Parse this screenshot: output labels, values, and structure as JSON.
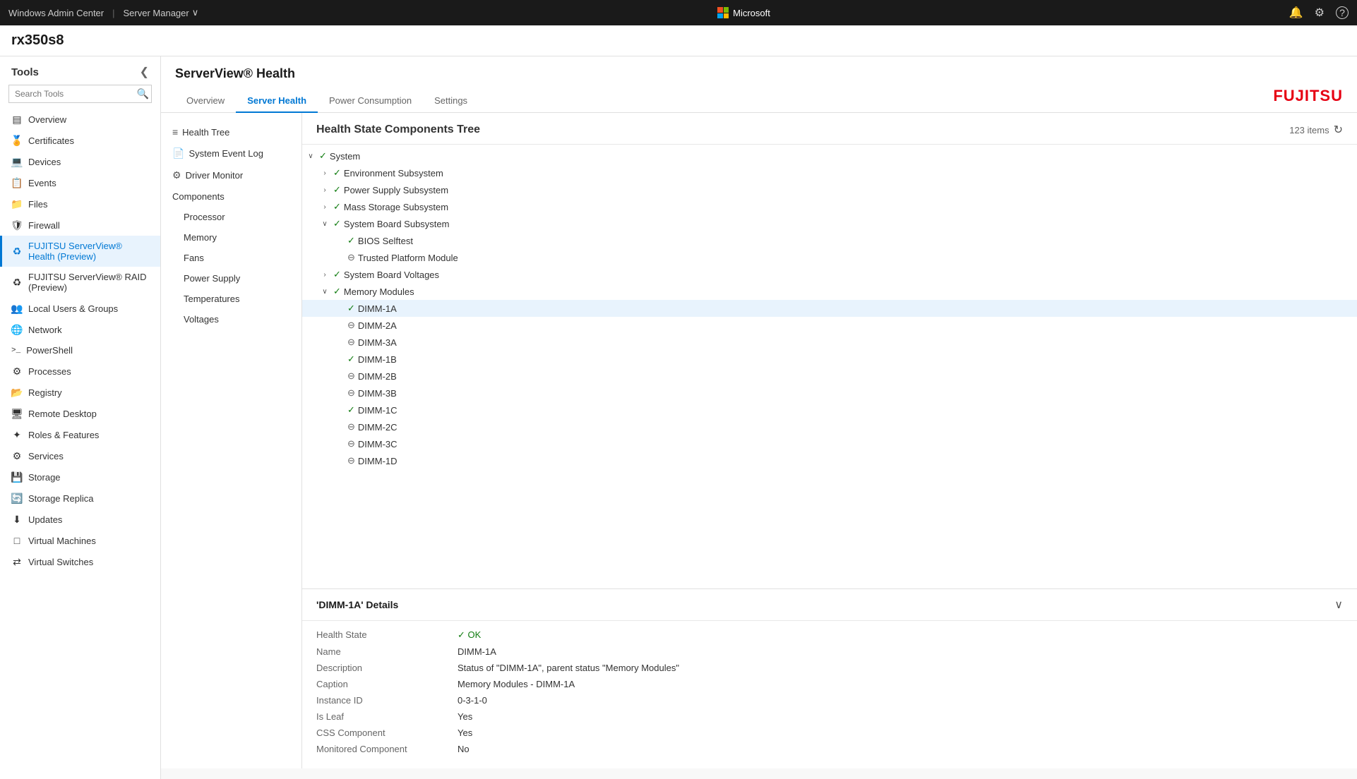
{
  "topbar": {
    "app_name": "Windows Admin Center",
    "server_label": "Server Manager",
    "microsoft_label": "Microsoft",
    "chevron": "∨",
    "bell_icon": "🔔",
    "gear_icon": "⚙",
    "help_icon": "?"
  },
  "server": {
    "name": "rx350s8"
  },
  "sidebar": {
    "title": "Tools",
    "collapse_icon": "❮",
    "search_placeholder": "Search Tools",
    "nav_items": [
      {
        "id": "overview",
        "label": "Overview",
        "icon": "▤"
      },
      {
        "id": "certificates",
        "label": "Certificates",
        "icon": "🏅"
      },
      {
        "id": "devices",
        "label": "Devices",
        "icon": "💻"
      },
      {
        "id": "events",
        "label": "Events",
        "icon": "📋"
      },
      {
        "id": "files",
        "label": "Files",
        "icon": "📁"
      },
      {
        "id": "firewall",
        "label": "Firewall",
        "icon": "🛡"
      },
      {
        "id": "fujitsu-health",
        "label": "FUJITSU ServerView® Health (Preview)",
        "icon": "♻",
        "active": true
      },
      {
        "id": "fujitsu-raid",
        "label": "FUJITSU ServerView® RAID (Preview)",
        "icon": "♻"
      },
      {
        "id": "local-users",
        "label": "Local Users & Groups",
        "icon": "👥"
      },
      {
        "id": "network",
        "label": "Network",
        "icon": "🌐"
      },
      {
        "id": "powershell",
        "label": "PowerShell",
        "icon": ">_"
      },
      {
        "id": "processes",
        "label": "Processes",
        "icon": "⚙"
      },
      {
        "id": "registry",
        "label": "Registry",
        "icon": "📂"
      },
      {
        "id": "remote-desktop",
        "label": "Remote Desktop",
        "icon": "🖥"
      },
      {
        "id": "roles-features",
        "label": "Roles & Features",
        "icon": "✦"
      },
      {
        "id": "services",
        "label": "Services",
        "icon": "⚙"
      },
      {
        "id": "storage",
        "label": "Storage",
        "icon": "💾"
      },
      {
        "id": "storage-replica",
        "label": "Storage Replica",
        "icon": "🔄"
      },
      {
        "id": "updates",
        "label": "Updates",
        "icon": "⬇"
      },
      {
        "id": "virtual-machines",
        "label": "Virtual Machines",
        "icon": "□"
      },
      {
        "id": "virtual-switches",
        "label": "Virtual Switches",
        "icon": "⇄"
      }
    ]
  },
  "plugin": {
    "title": "ServerView® Health",
    "tabs": [
      {
        "id": "overview",
        "label": "Overview"
      },
      {
        "id": "server-health",
        "label": "Server Health",
        "active": true
      },
      {
        "id": "power-consumption",
        "label": "Power Consumption"
      },
      {
        "id": "settings",
        "label": "Settings"
      }
    ],
    "fujitsu_logo": "FUJITSU"
  },
  "health_nav": {
    "items": [
      {
        "id": "health-tree",
        "label": "Health Tree",
        "icon": "≡",
        "level": 0
      },
      {
        "id": "system-event-log",
        "label": "System Event Log",
        "icon": "📄",
        "level": 0
      },
      {
        "id": "driver-monitor",
        "label": "Driver Monitor",
        "icon": "⚙",
        "level": 0
      },
      {
        "id": "components",
        "label": "Components",
        "icon": "",
        "level": 0
      },
      {
        "id": "processor",
        "label": "Processor",
        "level": 1
      },
      {
        "id": "memory",
        "label": "Memory",
        "level": 1
      },
      {
        "id": "fans",
        "label": "Fans",
        "level": 1
      },
      {
        "id": "power-supply",
        "label": "Power Supply",
        "level": 1
      },
      {
        "id": "temperatures",
        "label": "Temperatures",
        "level": 1
      },
      {
        "id": "voltages",
        "label": "Voltages",
        "level": 1
      }
    ]
  },
  "health_tree": {
    "title": "Health State Components Tree",
    "item_count": "123 items",
    "items": [
      {
        "id": "system",
        "label": "System",
        "status": "check",
        "level": 0,
        "expandable": true,
        "expanded": true
      },
      {
        "id": "env-subsystem",
        "label": "Environment Subsystem",
        "status": "check",
        "level": 1,
        "expandable": true
      },
      {
        "id": "power-supply-sub",
        "label": "Power Supply Subsystem",
        "status": "check",
        "level": 1,
        "expandable": true
      },
      {
        "id": "mass-storage-sub",
        "label": "Mass Storage Subsystem",
        "status": "check",
        "level": 1,
        "expandable": true
      },
      {
        "id": "system-board-sub",
        "label": "System Board Subsystem",
        "status": "check",
        "level": 1,
        "expandable": true,
        "expanded": true
      },
      {
        "id": "bios-selftest",
        "label": "BIOS Selftest",
        "status": "check",
        "level": 2,
        "expandable": false
      },
      {
        "id": "trusted-platform",
        "label": "Trusted Platform Module",
        "status": "dash",
        "level": 2,
        "expandable": false
      },
      {
        "id": "system-board-voltages",
        "label": "System Board Voltages",
        "status": "check",
        "level": 1,
        "expandable": true
      },
      {
        "id": "memory-modules",
        "label": "Memory Modules",
        "status": "check",
        "level": 1,
        "expandable": true,
        "expanded": true
      },
      {
        "id": "dimm-1a",
        "label": "DIMM-1A",
        "status": "check",
        "level": 2,
        "expandable": false,
        "selected": true
      },
      {
        "id": "dimm-2a",
        "label": "DIMM-2A",
        "status": "dash",
        "level": 2,
        "expandable": false
      },
      {
        "id": "dimm-3a",
        "label": "DIMM-3A",
        "status": "dash",
        "level": 2,
        "expandable": false
      },
      {
        "id": "dimm-1b",
        "label": "DIMM-1B",
        "status": "check",
        "level": 2,
        "expandable": false
      },
      {
        "id": "dimm-2b",
        "label": "DIMM-2B",
        "status": "dash",
        "level": 2,
        "expandable": false
      },
      {
        "id": "dimm-3b",
        "label": "DIMM-3B",
        "status": "dash",
        "level": 2,
        "expandable": false
      },
      {
        "id": "dimm-1c",
        "label": "DIMM-1C",
        "status": "check",
        "level": 2,
        "expandable": false
      },
      {
        "id": "dimm-2c",
        "label": "DIMM-2C",
        "status": "dash",
        "level": 2,
        "expandable": false
      },
      {
        "id": "dimm-3c",
        "label": "DIMM-3C",
        "status": "dash",
        "level": 2,
        "expandable": false
      },
      {
        "id": "dimm-1d",
        "label": "DIMM-1D",
        "status": "dash",
        "level": 2,
        "expandable": false
      }
    ]
  },
  "details": {
    "title": "'DIMM-1A' Details",
    "collapse_icon": "∨",
    "fields": [
      {
        "label": "Health State",
        "value": "✓ OK",
        "value_class": "ok"
      },
      {
        "label": "Name",
        "value": "DIMM-1A"
      },
      {
        "label": "Description",
        "value": "Status of \"DIMM-1A\", parent status \"Memory Modules\""
      },
      {
        "label": "Caption",
        "value": "Memory Modules - DIMM-1A"
      },
      {
        "label": "Instance ID",
        "value": "0-3-1-0"
      },
      {
        "label": "Is Leaf",
        "value": "Yes"
      },
      {
        "label": "CSS Component",
        "value": "Yes"
      },
      {
        "label": "Monitored Component",
        "value": "No"
      }
    ]
  }
}
